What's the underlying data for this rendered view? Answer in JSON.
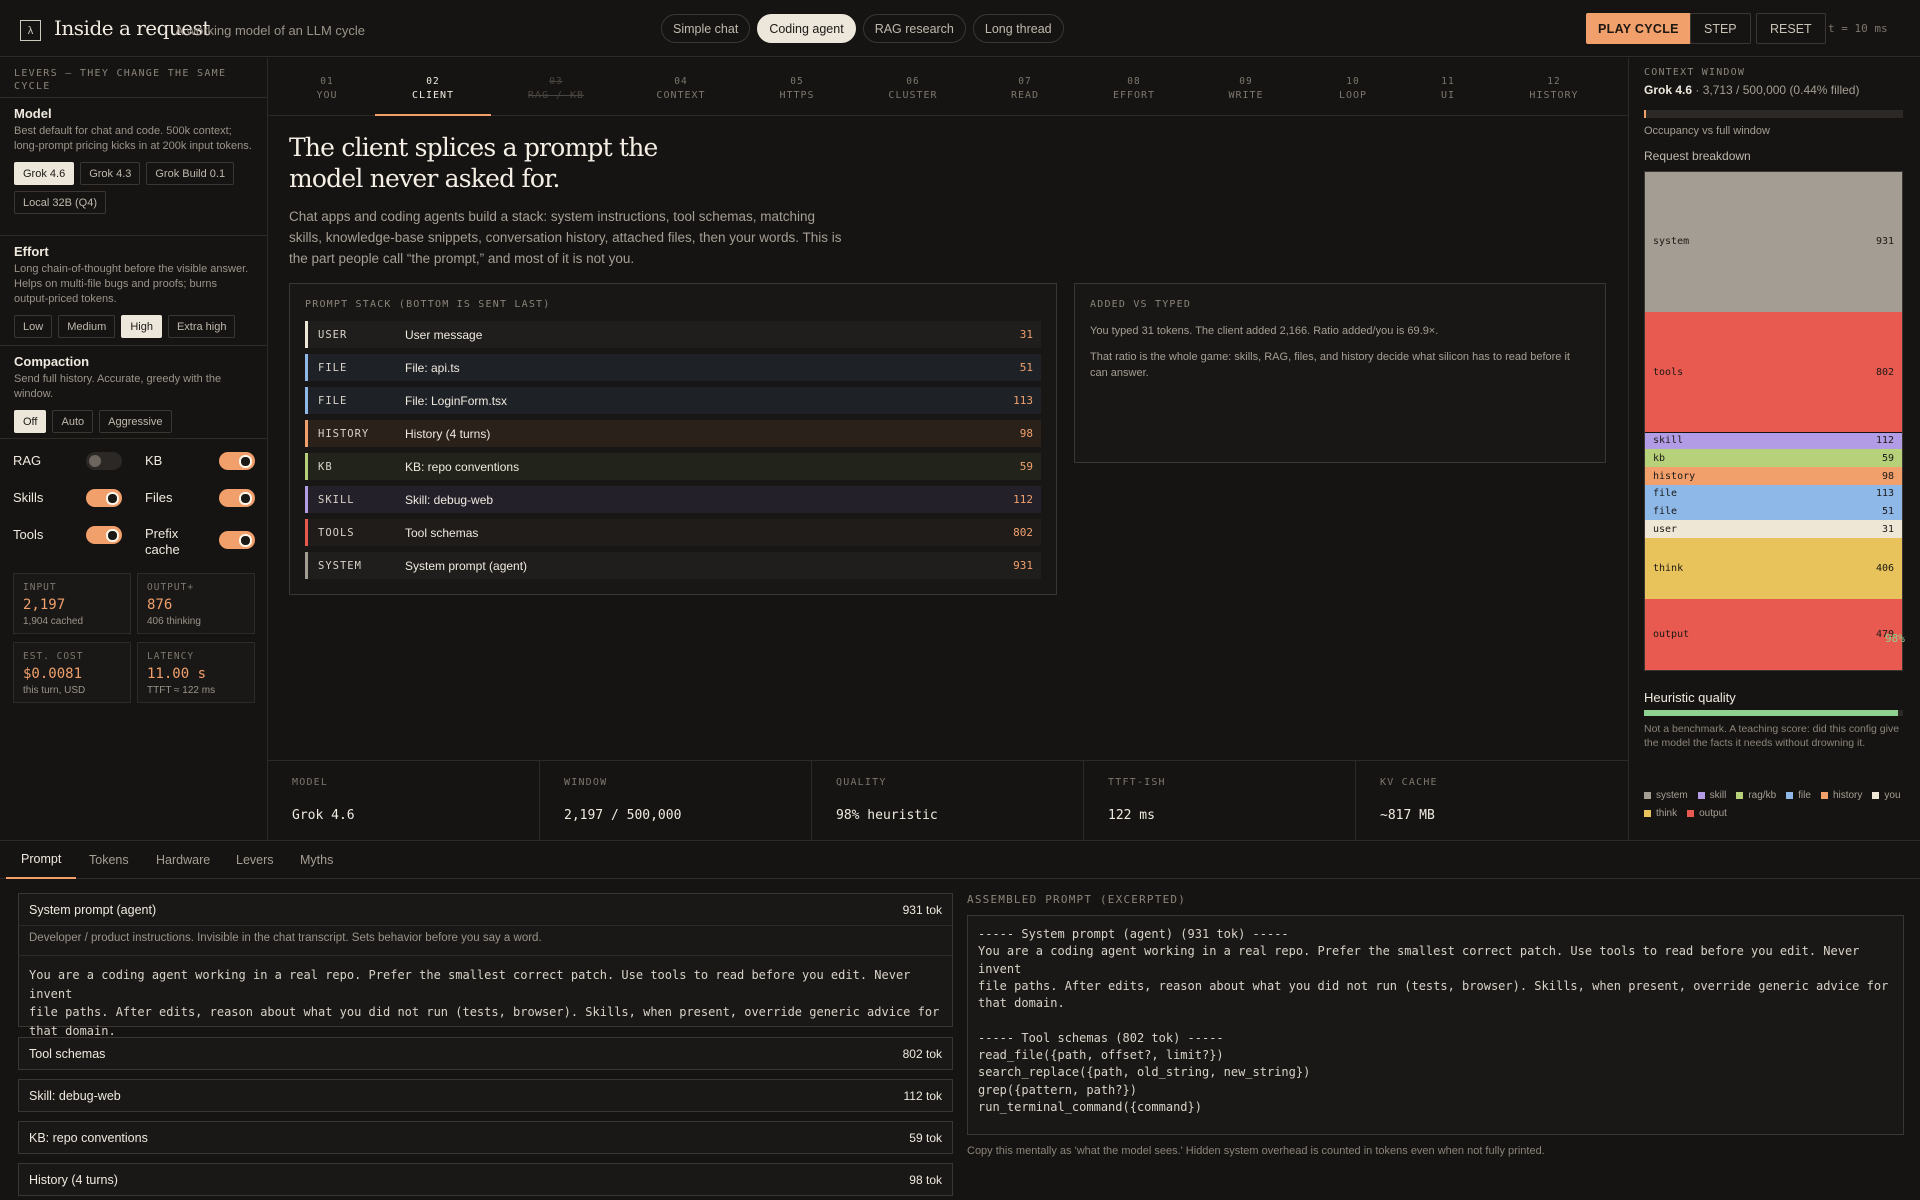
{
  "header": {
    "logo": "λ",
    "title": "Inside a request",
    "subtitle": "A working model of an LLM cycle",
    "scenarios": [
      {
        "label": "Simple chat",
        "active": false
      },
      {
        "label": "Coding agent",
        "active": true
      },
      {
        "label": "RAG research",
        "active": false
      },
      {
        "label": "Long thread",
        "active": false
      }
    ],
    "play_label": "PLAY CYCLE",
    "step_label": "STEP",
    "reset_label": "RESET",
    "tick": "t = 10 ms"
  },
  "sidebar": {
    "title": "LEVERS — THEY CHANGE THE SAME CYCLE",
    "model": {
      "title": "Model",
      "desc": "Best default for chat and code. 500k context; long-prompt pricing kicks in at 200k input tokens.",
      "options": [
        "Grok 4.6",
        "Grok 4.3",
        "Grok Build 0.1",
        "Local 32B (Q4)"
      ],
      "selected": "Grok 4.6"
    },
    "effort": {
      "title": "Effort",
      "desc": "Long chain-of-thought before the visible answer. Helps on multi-file bugs and proofs; burns output-priced tokens.",
      "options": [
        "Low",
        "Medium",
        "High",
        "Extra high"
      ],
      "selected": "High"
    },
    "compaction": {
      "title": "Compaction",
      "desc": "Send full history. Accurate, greedy with the window.",
      "options": [
        "Off",
        "Auto",
        "Aggressive"
      ],
      "selected": "Off"
    },
    "toggles": {
      "rag": {
        "label": "RAG",
        "on": false
      },
      "kb": {
        "label": "KB",
        "on": true
      },
      "skills": {
        "label": "Skills",
        "on": true
      },
      "files": {
        "label": "Files",
        "on": true
      },
      "tools": {
        "label": "Tools",
        "on": true
      },
      "prefix": {
        "label": "Prefix cache",
        "on": true
      }
    },
    "stats": {
      "input": {
        "label": "INPUT",
        "value": "2,197",
        "sub": "1,904 cached"
      },
      "output": {
        "label": "OUTPUT+",
        "value": "876",
        "sub": "406 thinking"
      },
      "cost": {
        "label": "EST. COST",
        "value": "$0.0081",
        "sub": "this turn, USD"
      },
      "latency": {
        "label": "LATENCY",
        "value": "11.00 s",
        "sub": "TTFT ≈ 122 ms"
      }
    }
  },
  "steps": [
    {
      "n": "01",
      "label": "YOU"
    },
    {
      "n": "02",
      "label": "CLIENT",
      "active": true
    },
    {
      "n": "03",
      "label": "RAG / KB",
      "strike": true
    },
    {
      "n": "04",
      "label": "CONTEXT"
    },
    {
      "n": "05",
      "label": "HTTPS"
    },
    {
      "n": "06",
      "label": "CLUSTER"
    },
    {
      "n": "07",
      "label": "READ"
    },
    {
      "n": "08",
      "label": "EFFORT"
    },
    {
      "n": "09",
      "label": "WRITE"
    },
    {
      "n": "10",
      "label": "LOOP"
    },
    {
      "n": "11",
      "label": "UI"
    },
    {
      "n": "12",
      "label": "HISTORY"
    }
  ],
  "main": {
    "headline": "The client splices a prompt the model never asked for.",
    "lede": "Chat apps and coding agents build a stack: system instructions, tool schemas, matching skills, knowledge-base snippets, conversation history, attached files, then your words. This is the part people call “the prompt,” and most of it is not you.",
    "stack": {
      "label": "PROMPT STACK (BOTTOM IS SENT LAST)",
      "rows": [
        {
          "tag": "USER",
          "name": "User message",
          "value": "31",
          "color": "#efe7d6",
          "bg": "#201e1c"
        },
        {
          "tag": "FILE",
          "name": "File: api.ts",
          "value": "51",
          "color": "#8db8e8",
          "bg": "#1e2226"
        },
        {
          "tag": "FILE",
          "name": "File: LoginForm.tsx",
          "value": "113",
          "color": "#8db8e8",
          "bg": "#1e2226"
        },
        {
          "tag": "HISTORY",
          "name": "History (4 turns)",
          "value": "98",
          "color": "#f1a06c",
          "bg": "#2a211b"
        },
        {
          "tag": "KB",
          "name": "KB: repo conventions",
          "value": "59",
          "color": "#b7d17a",
          "bg": "#22241b"
        },
        {
          "tag": "SKILL",
          "name": "Skill: debug-web",
          "value": "112",
          "color": "#b39ce6",
          "bg": "#232029"
        },
        {
          "tag": "TOOLS",
          "name": "Tool schemas",
          "value": "802",
          "color": "#e85a4f",
          "bg": "#201c1a"
        },
        {
          "tag": "SYSTEM",
          "name": "System prompt (agent)",
          "value": "931",
          "color": "#a49d93",
          "bg": "#201e1c"
        }
      ]
    },
    "added": {
      "label": "ADDED VS TYPED",
      "line1": "You typed 31 tokens. The client added 2,166. Ratio added/you is 69.9×.",
      "line2": "That ratio is the whole game: skills, RAG, files, and history decide what silicon has to read before it can answer."
    }
  },
  "metrics": [
    {
      "label": "MODEL",
      "value": "Grok 4.6"
    },
    {
      "label": "WINDOW",
      "value": "2,197 / 500,000"
    },
    {
      "label": "QUALITY",
      "value": "98% heuristic"
    },
    {
      "label": "TTFT-ISH",
      "value": "122 ms"
    },
    {
      "label": "KV CACHE",
      "value": "~817 MB"
    }
  ],
  "right": {
    "label": "CONTEXT WINDOW",
    "model": "Grok 4.6",
    "usage": " · 3,713 / 500,000 (0.44% filled)",
    "occupancy_fraction": 0.0044,
    "occupancy_label": "Occupancy vs full window",
    "breakdown_label": "Request breakdown",
    "segments": [
      {
        "name": "system",
        "value": 931,
        "color": "#a49d93"
      },
      {
        "name": "tools",
        "value": 802,
        "color": "#e85a4f"
      },
      {
        "name": "skill",
        "value": 112,
        "color": "#b39ce6"
      },
      {
        "name": "kb",
        "value": 59,
        "color": "#b7d17a"
      },
      {
        "name": "history",
        "value": 98,
        "color": "#f1a06c"
      },
      {
        "name": "file",
        "value": 113,
        "color": "#8db8e8"
      },
      {
        "name": "file",
        "value": 51,
        "color": "#8db8e8"
      },
      {
        "name": "user",
        "value": 31,
        "color": "#efe7d6"
      },
      {
        "name": "think",
        "value": 406,
        "color": "#e8c25a"
      },
      {
        "name": "output",
        "value": 470,
        "color": "#e85a4f"
      }
    ],
    "quality_label": "Heuristic quality",
    "quality_value": "98%",
    "quality_fraction": 0.98,
    "quality_desc": "Not a benchmark. A teaching score: did this config give the model the facts it needs without drowning it.",
    "legend": [
      {
        "name": "system",
        "color": "#a49d93"
      },
      {
        "name": "skill",
        "color": "#b39ce6"
      },
      {
        "name": "rag/kb",
        "color": "#b7d17a"
      },
      {
        "name": "file",
        "color": "#8db8e8"
      },
      {
        "name": "history",
        "color": "#f1a06c"
      },
      {
        "name": "you",
        "color": "#efe7d6"
      },
      {
        "name": "think",
        "color": "#e8c25a"
      },
      {
        "name": "output",
        "color": "#e85a4f"
      }
    ]
  },
  "bottom": {
    "tabs": [
      "Prompt",
      "Tokens",
      "Hardware",
      "Levers",
      "Myths"
    ],
    "active_tab": "Prompt",
    "system_block": {
      "title": "System prompt (agent)",
      "tokens": "931 tok",
      "desc": "Developer / product instructions. Invisible in the chat transcript. Sets behavior before you say a word.",
      "body": "You are a coding agent working in a real repo. Prefer the smallest correct patch. Use tools to read before you edit. Never invent\nfile paths. After edits, reason about what you did not run (tests, browser). Skills, when present, override generic advice for\nthat domain."
    },
    "collapsed": [
      {
        "title": "Tool schemas",
        "tokens": "802 tok"
      },
      {
        "title": "Skill: debug-web",
        "tokens": "112 tok"
      },
      {
        "title": "KB: repo conventions",
        "tokens": "59 tok"
      },
      {
        "title": "History (4 turns)",
        "tokens": "98 tok"
      }
    ],
    "assembled_label": "ASSEMBLED PROMPT (EXCERPTED)",
    "assembled_text": "----- System prompt (agent) (931 tok) -----\nYou are a coding agent working in a real repo. Prefer the smallest correct patch. Use tools to read before you edit. Never invent\nfile paths. After edits, reason about what you did not run (tests, browser). Skills, when present, override generic advice for\nthat domain.\n\n----- Tool schemas (802 tok) -----\nread_file({path, offset?, limit?})\nsearch_replace({path, old_string, new_string})\ngrep({pattern, path?})\nrun_terminal_command({command})\n\nEach schema includes JSON types, required fields, and a one-paragraph description. The model only 'uses' a tool by emitting a",
    "assembled_note": "Copy this mentally as 'what the model sees.' Hidden system overhead is counted in tokens even when not fully printed."
  }
}
